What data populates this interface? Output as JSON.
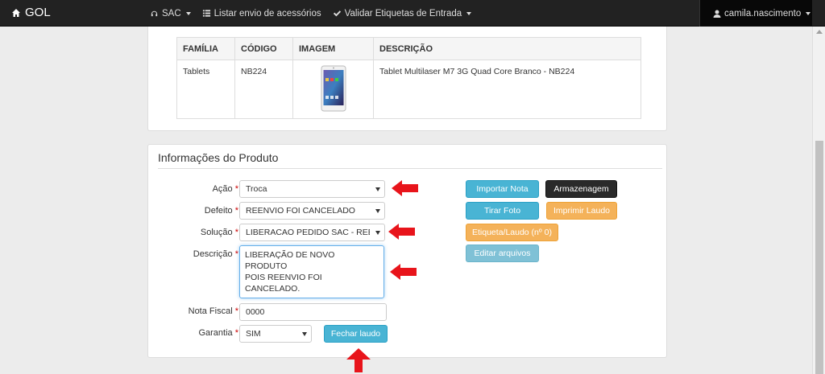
{
  "navbar": {
    "brand": "GOL",
    "items": [
      {
        "label": "SAC",
        "icon": "headphones-icon"
      },
      {
        "label": "Listar envio de acessórios",
        "icon": "list-icon"
      },
      {
        "label": "Validar Etiquetas de Entrada",
        "icon": "check-icon"
      }
    ],
    "user": "camila.nascimento"
  },
  "product_table": {
    "headers": [
      "FAMÍLIA",
      "CÓDIGO",
      "IMAGEM",
      "DESCRIÇÃO"
    ],
    "rows": [
      {
        "familia": "Tablets",
        "codigo": "NB224",
        "descricao": "Tablet Multilaser M7 3G Quad Core Branco - NB224"
      }
    ]
  },
  "info_panel": {
    "title": "Informações do Produto",
    "fields": {
      "acao": {
        "label": "Ação",
        "value": "Troca"
      },
      "defeito": {
        "label": "Defeito",
        "value": "REENVIO FOI CANCELADO"
      },
      "solucao": {
        "label": "Solução",
        "value": "LIBERACAO PEDIDO SAC - REENVIO"
      },
      "descricao": {
        "label": "Descrição",
        "line1": "LIBERAÇÃO DE NOVO PRODUTO",
        "line2": "POIS REENVIO FOI CANCELADO."
      },
      "nota_fiscal": {
        "label": "Nota Fiscal",
        "value": "0000"
      },
      "garantia": {
        "label": "Garantia",
        "value": "SIM"
      }
    },
    "required_mark": "*",
    "buttons": {
      "importar_nota": "Importar Nota",
      "armazenagem": "Armazenagem",
      "tirar_foto": "Tirar Foto",
      "imprimir_laudo": "Imprimir Laudo",
      "etiqueta_laudo": "Etiqueta/Laudo (nº 0)",
      "editar_arquivos": "Editar arquivos",
      "fechar_laudo": "Fechar laudo"
    }
  },
  "colors": {
    "navbar": "#222222",
    "info_button": "#49b4d4",
    "warning_button": "#f4b25a",
    "dark_button": "#2a2a2a",
    "annotation_arrow": "#e8141b"
  }
}
